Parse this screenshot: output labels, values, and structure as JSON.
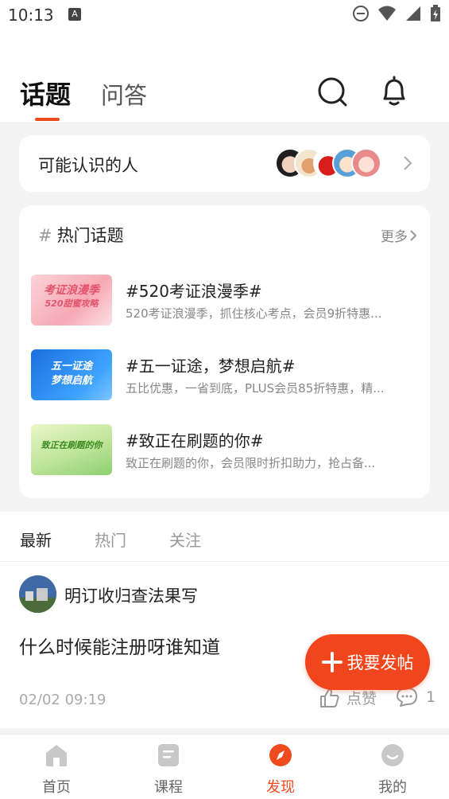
{
  "status_bar": {
    "time": "10:13",
    "badge": "A"
  },
  "header": {
    "tabs": [
      {
        "label": "话题",
        "active": true
      },
      {
        "label": "问答",
        "active": false
      }
    ],
    "accent_color": "#f04a1f"
  },
  "people_card": {
    "title": "可能认识的人"
  },
  "hot_topics": {
    "title": "热门话题",
    "hash": "#",
    "more": "更多",
    "items": [
      {
        "title": "#520考证浪漫季#",
        "desc": "520考证浪漫季，抓住核心考点，会员9折特惠...",
        "thumb_line1": "考证浪漫季",
        "thumb_line2": "520甜蜜攻略"
      },
      {
        "title": "#五一证途，梦想启航#",
        "desc": "五比优惠，一省到底，PLUS会员85折特惠，精...",
        "thumb_line1": "五一证途",
        "thumb_line2": "梦想启航"
      },
      {
        "title": "#致正在刷题的你#",
        "desc": "致正在刷题的你，会员限时折扣助力，抢占备...",
        "thumb_line1": "致正在刷题的你",
        "thumb_line2": ""
      }
    ]
  },
  "feed": {
    "tabs": [
      {
        "label": "最新",
        "active": true
      },
      {
        "label": "热门",
        "active": false
      },
      {
        "label": "关注",
        "active": false
      }
    ],
    "post": {
      "user": "明订收归查法果写",
      "body": "什么时候能注册呀谁知道",
      "date": "02/02 09:19",
      "like_label": "点赞",
      "comment_count": "1"
    }
  },
  "fab": {
    "label": "我要发帖",
    "color": "#f1461d"
  },
  "bottom_nav": {
    "items": [
      {
        "label": "首页",
        "icon": "home-icon",
        "active": false
      },
      {
        "label": "课程",
        "icon": "course-icon",
        "active": false
      },
      {
        "label": "发现",
        "icon": "discover-icon",
        "active": true
      },
      {
        "label": "我的",
        "icon": "profile-icon",
        "active": false
      }
    ]
  }
}
